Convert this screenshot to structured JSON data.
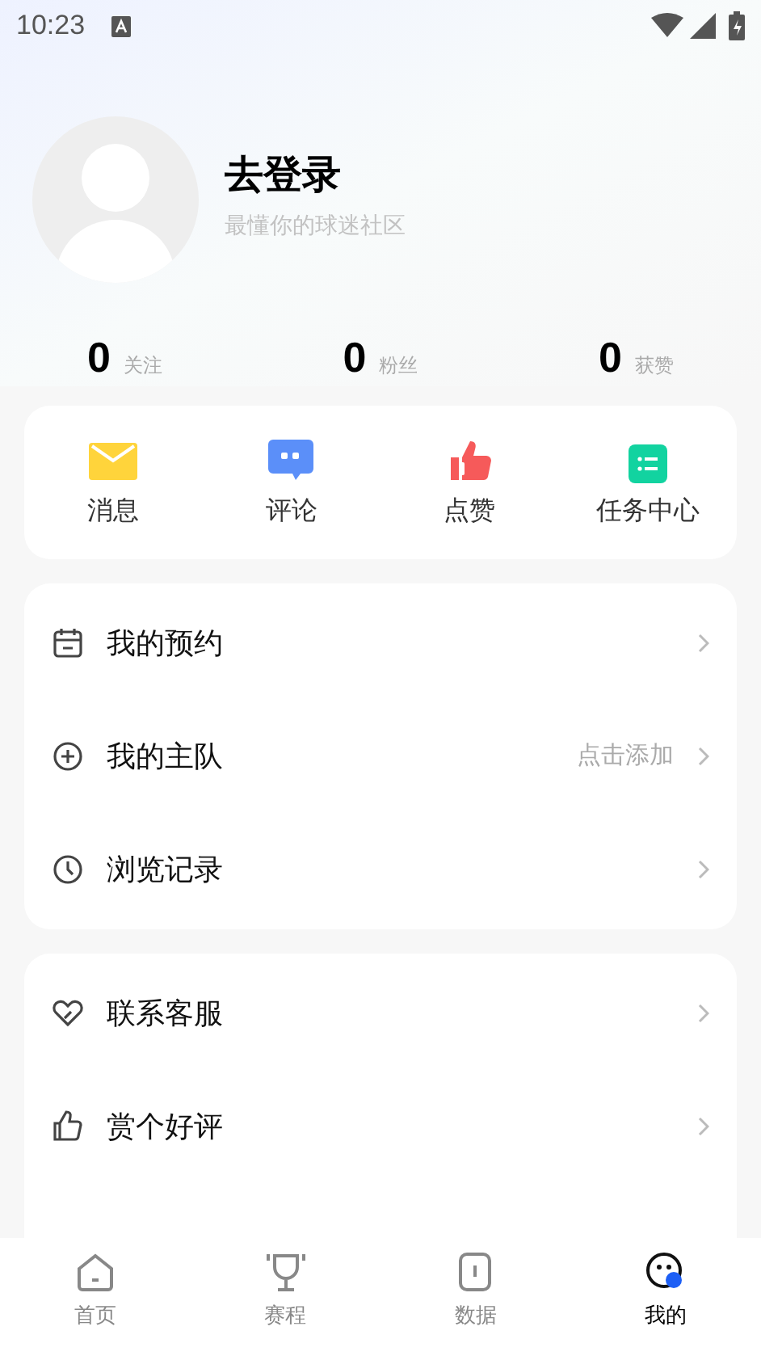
{
  "status_bar": {
    "time": "10:23"
  },
  "profile": {
    "name": "去登录",
    "tagline": "最懂你的球迷社区"
  },
  "stats": [
    {
      "value": "0",
      "label": "关注"
    },
    {
      "value": "0",
      "label": "粉丝"
    },
    {
      "value": "0",
      "label": "获赞"
    }
  ],
  "shortcuts": [
    {
      "kind": "mail",
      "label": "消息",
      "color": "#ffd43b"
    },
    {
      "kind": "comment",
      "label": "评论",
      "color": "#5b8ff9"
    },
    {
      "kind": "like",
      "label": "点赞",
      "color": "#f65a5a"
    },
    {
      "kind": "tasks",
      "label": "任务中心",
      "color": "#12d3a0"
    }
  ],
  "menu_groups": [
    [
      {
        "kind": "calendar",
        "label": "我的预约"
      },
      {
        "kind": "plus",
        "label": "我的主队",
        "hint": "点击添加"
      },
      {
        "kind": "clock",
        "label": "浏览记录"
      }
    ],
    [
      {
        "kind": "heart",
        "label": "联系客服"
      },
      {
        "kind": "thumb",
        "label": "赏个好评"
      }
    ]
  ],
  "tab_bar": [
    {
      "kind": "home",
      "label": "首页",
      "selected": false
    },
    {
      "kind": "trophy",
      "label": "赛程",
      "selected": false
    },
    {
      "kind": "data",
      "label": "数据",
      "selected": false
    },
    {
      "kind": "me",
      "label": "我的",
      "selected": true
    }
  ]
}
